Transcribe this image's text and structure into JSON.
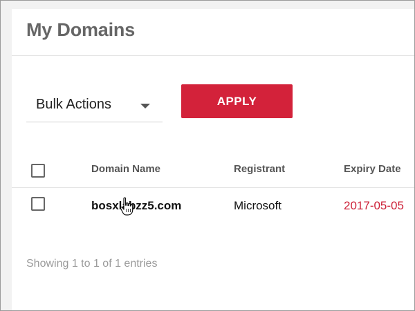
{
  "page": {
    "title": "My Domains"
  },
  "toolbar": {
    "bulk_actions": {
      "selected": "Bulk Actions",
      "icon": "chevron-down-icon"
    },
    "apply_label": "APPLY",
    "apply_color": "#d3223a"
  },
  "table": {
    "columns": [
      "Domain Name",
      "Registrant",
      "Expiry Date"
    ],
    "rows": [
      {
        "checked": false,
        "domain": "bosxlabzz5.com",
        "registrant": "Microsoft",
        "expiry": "2017-05-05"
      }
    ]
  },
  "footer": {
    "info": "Showing 1 to 1 of 1 entries"
  },
  "colors": {
    "accent": "#d3223a",
    "expiry_text": "#cc1f36",
    "title_text": "#666666"
  }
}
